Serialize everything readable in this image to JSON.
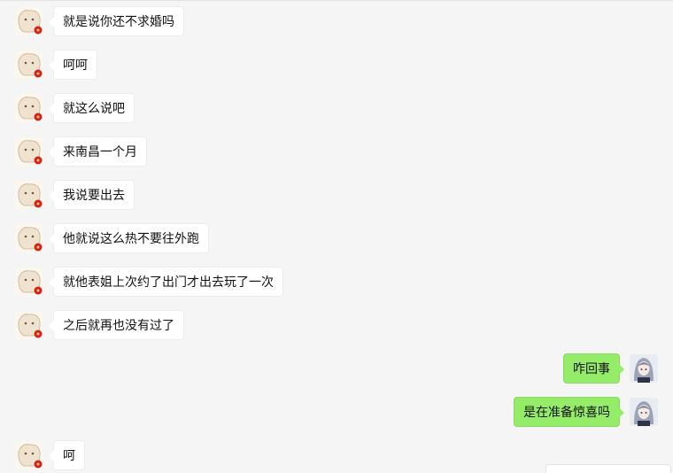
{
  "colors": {
    "background": "#f5f5f5",
    "sent_bubble": "#95ec69",
    "received_bubble": "#ffffff"
  },
  "messages": [
    {
      "side": "left",
      "text": "就是说你还不求婚吗",
      "avatar": "contact-avatar-icon"
    },
    {
      "side": "left",
      "text": "呵呵",
      "avatar": "contact-avatar-icon"
    },
    {
      "side": "left",
      "text": "就这么说吧",
      "avatar": "contact-avatar-icon"
    },
    {
      "side": "left",
      "text": "来南昌一个月",
      "avatar": "contact-avatar-icon"
    },
    {
      "side": "left",
      "text": "我说要出去",
      "avatar": "contact-avatar-icon"
    },
    {
      "side": "left",
      "text": "他就说这么热不要往外跑",
      "avatar": "contact-avatar-icon"
    },
    {
      "side": "left",
      "text": "就他表姐上次约了出门才出去玩了一次",
      "avatar": "contact-avatar-icon"
    },
    {
      "side": "left",
      "text": "之后就再也没有过了",
      "avatar": "contact-avatar-icon"
    },
    {
      "side": "right",
      "text": "咋回事",
      "avatar": "self-avatar-icon"
    },
    {
      "side": "right",
      "text": "是在准备惊喜吗",
      "avatar": "self-avatar-icon"
    },
    {
      "side": "left",
      "text": "呵",
      "avatar": "contact-avatar-icon"
    }
  ]
}
